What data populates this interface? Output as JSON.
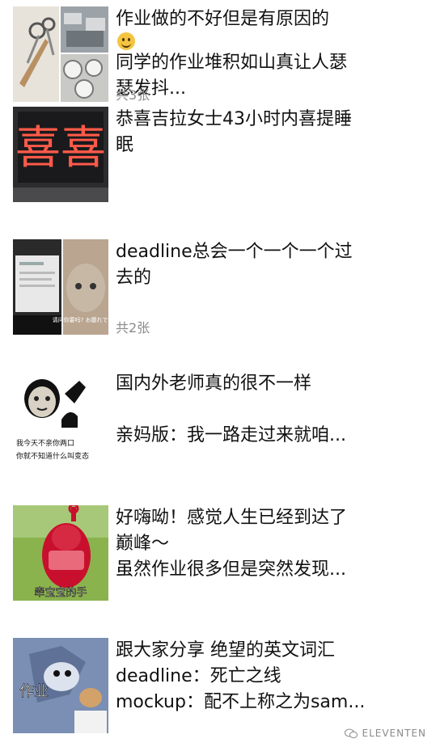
{
  "posts": [
    {
      "title": "作业做的不好但是有原因的",
      "title_emoji": "smile-emoji",
      "lines": [
        "同学的作业堆积如山真让人瑟",
        "瑟发抖..."
      ],
      "image_count": "共3张"
    },
    {
      "lines": [
        "恭喜吉拉女士43小时内喜提睡",
        "眠"
      ],
      "image_caption": "喜喜"
    },
    {
      "lines": [
        "deadline总会一个一个一个过",
        "去的"
      ],
      "image_count": "共2张",
      "image_caption": "请问你要吗? お腹れですか"
    },
    {
      "lines": [
        "国内外老师真的很不一样",
        "",
        "亲妈版：我一路走过来就咱..."
      ],
      "image_caption_line1": "我今天不亲你两口",
      "image_caption_line2": "你就不知道什么叫变态"
    },
    {
      "lines": [
        "好嗨呦！感觉人生已经到达了",
        "巅峰～",
        "虽然作业很多但是突然发现..."
      ],
      "image_caption": "牵宝宝的手"
    },
    {
      "lines": [
        "跟大家分享 绝望的英文词汇",
        "deadline：死亡之线",
        "mockup：配不上称之为sam..."
      ],
      "image_caption": "作业"
    }
  ],
  "watermark": {
    "icon": "wechat-icon",
    "text": "ELEVENTEN"
  },
  "colors": {
    "text": "#111111",
    "meta": "#8a8a8a",
    "background": "#ffffff"
  }
}
